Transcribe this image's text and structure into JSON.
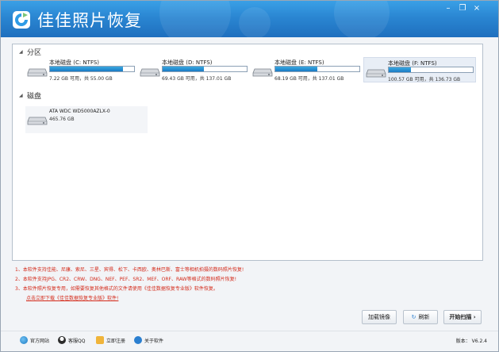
{
  "app": {
    "title": "佳佳照片恢复",
    "window_controls": [
      "minimize-icon",
      "restore-icon",
      "close-icon"
    ]
  },
  "partitions": {
    "header": "分区",
    "drives": [
      {
        "name": "本地磁盘 (C: NTFS)",
        "size_text": "7.22 GB 可用，共 55.00 GB",
        "used_fraction": 0.87,
        "selected": false
      },
      {
        "name": "本地磁盘 (D: NTFS)",
        "size_text": "69.43 GB 可用，共 137.01 GB",
        "used_fraction": 0.49,
        "selected": false
      },
      {
        "name": "本地磁盘 (E: NTFS)",
        "size_text": "68.19 GB 可用，共 137.01 GB",
        "used_fraction": 0.5,
        "selected": false
      },
      {
        "name": "本地磁盘 (F: NTFS)",
        "size_text": "100.57 GB 可用，共 136.73 GB",
        "used_fraction": 0.26,
        "selected": true
      }
    ]
  },
  "disks": {
    "header": "磁盘",
    "items": [
      {
        "name": "ATA WDC WD5000AZLX-0",
        "size_text": "465.76 GB"
      }
    ]
  },
  "notes": [
    "1、本软件支持佳能、尼康、索尼、三星、宾得、松下、卡西欧、奥林巴斯、富士等相机拍摄的数码照片恢复!",
    "2、本软件支持JPG、CR2、CRW、DNG、NEF、PEF、SR2、MEF、ORF、RAW等格式的数码照片恢复!",
    "3、本软件照片恢复专用，如需要恢复其他格式的文件请使用《佳佳数据恢复专业版》软件恢复。"
  ],
  "download_link": "点击立即下载《佳佳数据恢复专业版》软件!",
  "buttons": {
    "load_image": "加载镜像",
    "refresh": "刷新",
    "start_scan": "开始扫描"
  },
  "footer": {
    "official_site": "官方网站",
    "support_qq": "客服QQ",
    "register": "立即注册",
    "about": "关于软件",
    "version": "版本：  V6.2.4"
  },
  "colors": {
    "title_bar": "#2a86d2",
    "usage_bar": "#1a7ac4",
    "note_text": "#d42a1a"
  }
}
